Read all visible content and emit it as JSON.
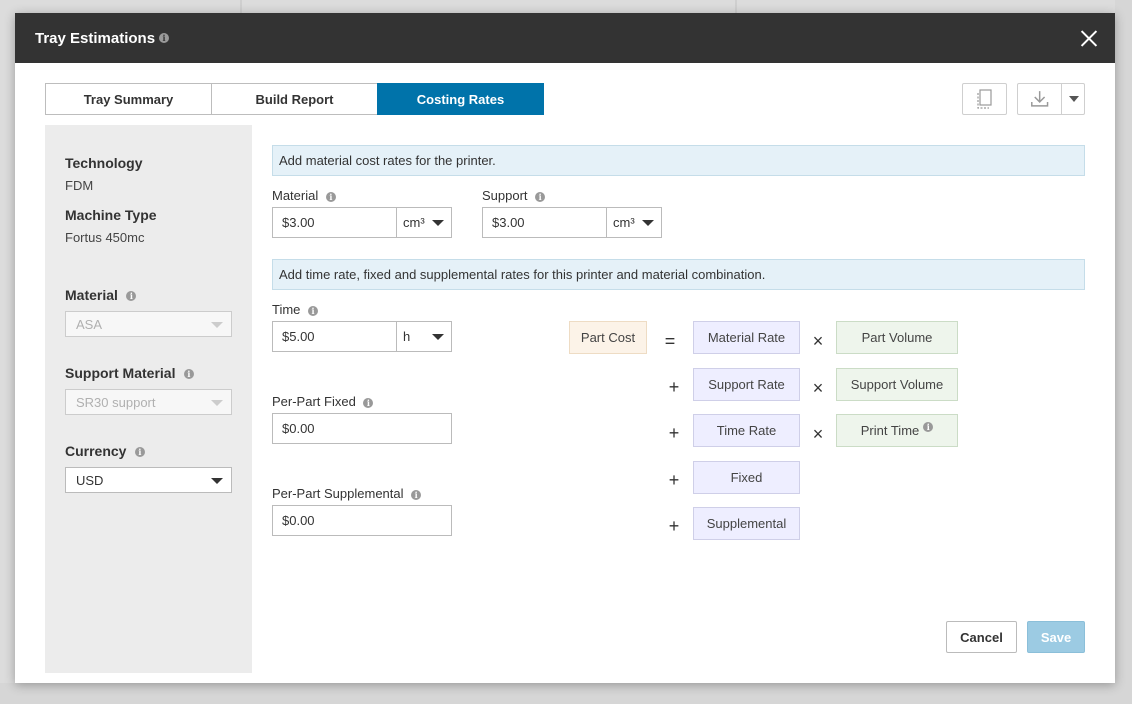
{
  "modal": {
    "title": "Tray Estimations"
  },
  "tabs": [
    {
      "label": "Tray Summary"
    },
    {
      "label": "Build Report"
    },
    {
      "label": "Costing Rates"
    }
  ],
  "toolbar": {
    "copy_icon": "copy-icon",
    "download_icon": "download-icon"
  },
  "sidebar": {
    "technology": {
      "label": "Technology",
      "value": "FDM"
    },
    "machine_type": {
      "label": "Machine Type",
      "value": "Fortus 450mc"
    },
    "material": {
      "label": "Material",
      "value": "ASA"
    },
    "support_material": {
      "label": "Support Material",
      "value": "SR30 support"
    },
    "currency": {
      "label": "Currency",
      "value": "USD"
    }
  },
  "material_banner": "Add material cost rates for the printer.",
  "material_rate": {
    "label": "Material",
    "value": "$3.00",
    "unit": "cm³"
  },
  "support_rate": {
    "label": "Support",
    "value": "$3.00",
    "unit": "cm³"
  },
  "time_banner": "Add time rate, fixed and supplemental rates for this printer and material combination.",
  "time_rate": {
    "label": "Time",
    "value": "$5.00",
    "unit": "h"
  },
  "per_part_fixed": {
    "label": "Per-Part Fixed",
    "value": "$0.00"
  },
  "per_part_supplemental": {
    "label": "Per-Part Supplemental",
    "value": "$0.00"
  },
  "formula": {
    "part_cost": "Part Cost",
    "equals": "=",
    "plus": "+",
    "times": "×",
    "material_rate": "Material Rate",
    "part_volume": "Part Volume",
    "support_rate": "Support Rate",
    "support_volume": "Support Volume",
    "time_rate": "Time Rate",
    "print_time": "Print Time",
    "fixed": "Fixed",
    "supplemental": "Supplemental"
  },
  "buttons": {
    "cancel": "Cancel",
    "save": "Save"
  },
  "colors": {
    "header": "#333333",
    "accent": "#0073aa",
    "save_disabled": "#9ccbe3"
  }
}
